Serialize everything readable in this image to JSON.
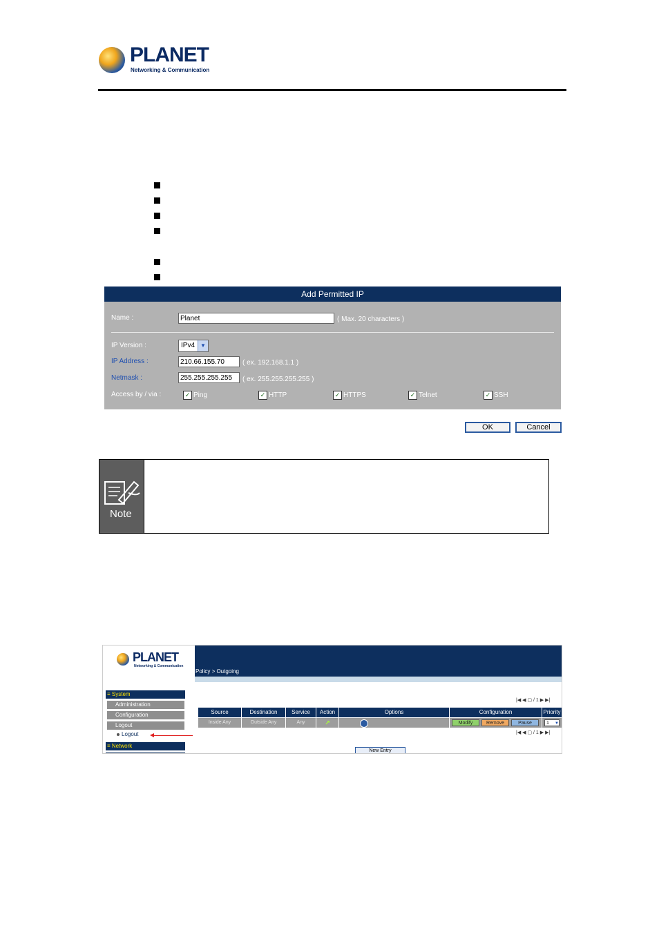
{
  "header": {
    "logo_name": "PLANET",
    "logo_tagline": "Networking & Communication"
  },
  "dialog": {
    "title": "Add Permitted IP",
    "name_label": "Name :",
    "name_value": "Planet",
    "name_hint": "( Max. 20 characters )",
    "ipversion_label": "IP Version :",
    "ipversion_value": "IPv4",
    "ipaddress_label": "IP Address :",
    "ipaddress_value": "210.66.155.70",
    "ipaddress_hint": "( ex. 192.168.1.1 )",
    "netmask_label": "Netmask :",
    "netmask_value": "255.255.255.255",
    "netmask_hint": "( ex. 255.255.255.255 )",
    "access_label": "Access by / via :",
    "access_options": [
      {
        "label": "Ping",
        "checked": true
      },
      {
        "label": "HTTP",
        "checked": true
      },
      {
        "label": "HTTPS",
        "checked": true
      },
      {
        "label": "Telnet",
        "checked": true
      },
      {
        "label": "SSH",
        "checked": true
      }
    ],
    "ok_label": "OK",
    "cancel_label": "Cancel"
  },
  "note": {
    "label": "Note"
  },
  "screenshot": {
    "logo_name": "PLANET",
    "logo_tagline": "Networking & Communication",
    "breadcrumb": "Policy > Outgoing",
    "nav": {
      "system": "System",
      "administration": "Administration",
      "configuration": "Configuration",
      "logout": "Logout",
      "logout_leaf": "Logout",
      "network": "Network"
    },
    "columns": [
      "Source",
      "Destination",
      "Service",
      "Action",
      "Options",
      "Configuration",
      "Priority"
    ],
    "row": {
      "source": "Inside Any",
      "destination": "Outside Any",
      "service": "Any",
      "modify": "Modify",
      "remove": "Remove",
      "pause": "Pause",
      "priority": "1"
    },
    "pager_text": "/ 1",
    "new_entry": "New Entry"
  },
  "colors": {
    "navy": "#0d2f5e",
    "dialog_gray": "#b2b2b2",
    "modify": "#8fd16a",
    "remove": "#f0a860",
    "pause": "#8fb6e0"
  }
}
